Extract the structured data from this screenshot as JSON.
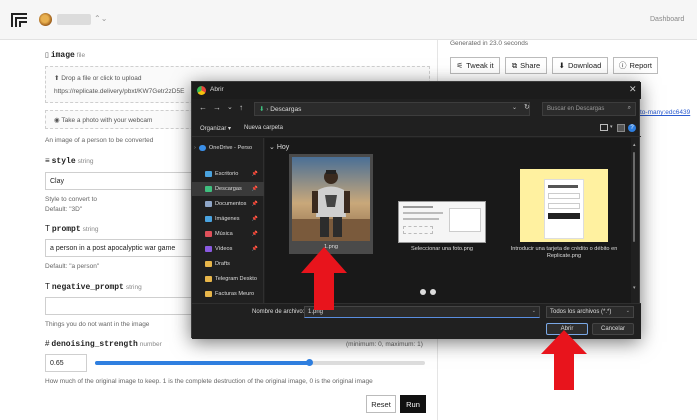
{
  "topbar": {
    "dashboard_label": "Dashboard"
  },
  "form": {
    "image": {
      "name": "image",
      "type": "file",
      "drop_text": "Drop a file or click to upload",
      "url_value": "https://replicate.delivery/pbxt/KW7Getr2zD5E",
      "webcam_text": "Take a photo with your webcam",
      "help": "An image of a person to be converted"
    },
    "style": {
      "name": "style",
      "type": "string",
      "value": "Clay",
      "help": "Style to convert to",
      "default": "Default: \"3D\""
    },
    "prompt": {
      "name": "prompt",
      "type": "string",
      "value": "a person in a post apocalyptic war game",
      "default": "Default: \"a person\""
    },
    "negative_prompt": {
      "name": "negative_prompt",
      "type": "string",
      "value": "",
      "help": "Things you do not want in the image"
    },
    "denoising_strength": {
      "name": "denoising_strength",
      "type": "number",
      "range": "(minimum: 0, maximum: 1)",
      "value": "0.65",
      "slider_fraction": 0.65,
      "help": "How much of the original image to keep. 1 is the complete destruction of the original image, 0 is the original image"
    },
    "reset_label": "Reset",
    "run_label": "Run"
  },
  "output": {
    "generated_text": "Generated in 23.0 seconds",
    "tweak_label": "Tweak it",
    "share_label": "Share",
    "download_label": "Download",
    "report_label": "Report",
    "link_text": "to-many:edc6439"
  },
  "dialog": {
    "title": "Abrir",
    "path": "Descargas",
    "search_placeholder": "Buscar en Descargas",
    "organize_label": "Organizar",
    "new_folder_label": "Nueva carpeta",
    "group_header": "Hoy",
    "sidebar_items": [
      {
        "label": "OneDrive - Perso",
        "icon": "cloud-icon",
        "color": "#3a8ee6"
      },
      {
        "label": "Escritorio",
        "icon": "desktop-icon",
        "color": "#4aa3df"
      },
      {
        "label": "Descargas",
        "icon": "download-icon",
        "color": "#3fbf7f"
      },
      {
        "label": "Documentos",
        "icon": "document-icon",
        "color": "#8fa6c8"
      },
      {
        "label": "Imágenes",
        "icon": "pictures-icon",
        "color": "#4aa3df"
      },
      {
        "label": "Música",
        "icon": "music-icon",
        "color": "#e0505a"
      },
      {
        "label": "Vídeos",
        "icon": "video-icon",
        "color": "#8a5ae0"
      },
      {
        "label": "Drafts",
        "icon": "folder-icon",
        "color": "#e8b64a"
      },
      {
        "label": "Telegram Deskto",
        "icon": "folder-icon",
        "color": "#e8b64a"
      },
      {
        "label": "Facturas Meuro",
        "icon": "folder-icon",
        "color": "#e8b64a"
      }
    ],
    "files": [
      {
        "name": "1.png"
      },
      {
        "name": "Seleccionar una foto.png"
      },
      {
        "name": "Introducir una tarjeta de crédito o débito en Replicate.png"
      }
    ],
    "filename_label": "Nombre de archivo:",
    "filename_value": "1.png",
    "filetype_value": "Todos los archivos (*.*)",
    "open_label": "Abrir",
    "cancel_label": "Cancelar"
  },
  "colors": {
    "accent_red": "#e8141c",
    "slider_blue": "#2f7fe0",
    "dialog_bg": "#202020"
  }
}
